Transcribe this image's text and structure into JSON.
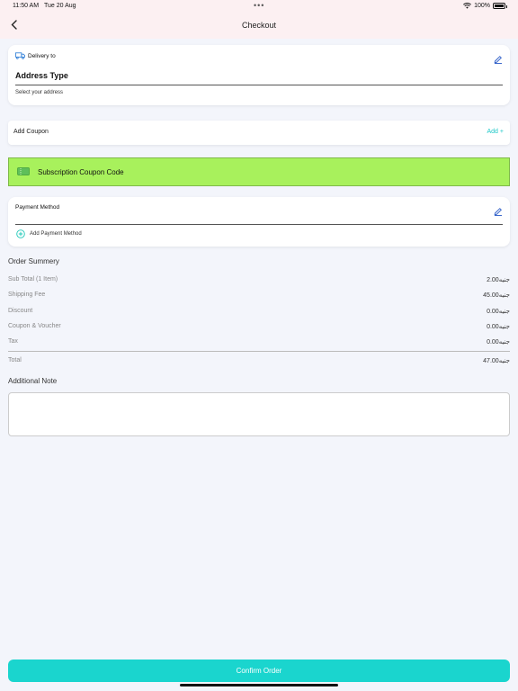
{
  "status": {
    "time": "11:50 AM",
    "date": "Tue 20 Aug",
    "battery": "100%"
  },
  "header": {
    "title": "Checkout"
  },
  "delivery": {
    "label": "Delivery to",
    "address_type": "Address Type",
    "hint": "Select your address"
  },
  "coupon": {
    "label": "Add Coupon",
    "action": "Add +"
  },
  "subscription_coupon": {
    "label": "Subscription Coupon Code"
  },
  "payment": {
    "title": "Payment Method",
    "add_label": "Add Payment Method"
  },
  "summary": {
    "title": "Order Summery",
    "rows": [
      {
        "label": "Sub Total (1 Item)",
        "value": "2.00جنيه"
      },
      {
        "label": "Shipping Fee",
        "value": "45.00جنيه"
      },
      {
        "label": "Discount",
        "value": "0.00جنيه"
      },
      {
        "label": "Coupon & Voucher",
        "value": "0.00جنيه"
      },
      {
        "label": "Tax",
        "value": "0.00جنيه"
      },
      {
        "label": "Total",
        "value": "47.00جنيه"
      }
    ]
  },
  "note": {
    "title": "Additional Note",
    "value": ""
  },
  "confirm": {
    "label": "Confirm Order"
  },
  "colors": {
    "accent": "#1ad5ce",
    "coupon_highlight": "#a8f15c",
    "header_bg": "#fcf0f2"
  }
}
